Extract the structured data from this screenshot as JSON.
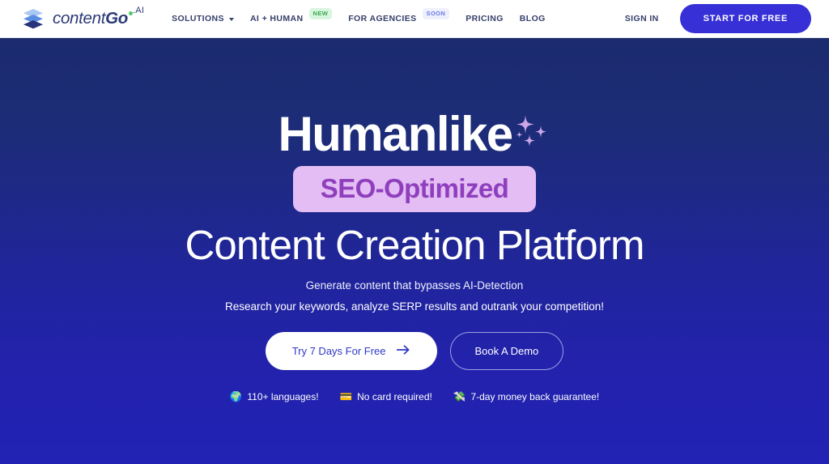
{
  "header": {
    "brand": {
      "logo_icon": "layers-stack-icon",
      "text_light": "content",
      "text_bold": "Go",
      "dot_color": "#4ec96a",
      "suffix": ".AI"
    },
    "nav": [
      {
        "label": "SOLUTIONS",
        "has_caret": true,
        "badge": null
      },
      {
        "label": "AI + HUMAN",
        "has_caret": false,
        "badge": "NEW",
        "badge_type": "new"
      },
      {
        "label": "FOR AGENCIES",
        "has_caret": false,
        "badge": "SOON",
        "badge_type": "soon"
      },
      {
        "label": "PRICING",
        "has_caret": false,
        "badge": null
      },
      {
        "label": "BLOG",
        "has_caret": false,
        "badge": null
      }
    ],
    "sign_in": "SIGN IN",
    "start_free": "START FOR FREE"
  },
  "hero": {
    "headline_line1": "Humanlike",
    "headline_badge": "SEO-Optimized",
    "headline_line3": "Content Creation Platform",
    "subtitle_1": "Generate content that bypasses AI-Detection",
    "subtitle_2": "Research your keywords, analyze SERP results and outrank your competition!",
    "cta_primary": "Try 7 Days For Free",
    "cta_secondary": "Book A Demo",
    "features": [
      {
        "emoji": "🌍",
        "icon_name": "globe-icon",
        "label": "110+ languages!"
      },
      {
        "emoji": "💳",
        "icon_name": "credit-card-icon",
        "label": "No card required!"
      },
      {
        "emoji": "💸",
        "icon_name": "money-flying-icon",
        "label": "7-day money back guarantee!"
      }
    ]
  },
  "colors": {
    "brand_navy": "#2b3a77",
    "accent_blue": "#3730d6",
    "badge_bg": "#e3bdf3",
    "badge_text": "#8f3fbe",
    "hero_top": "#1b2b6e",
    "hero_bottom": "#2222b4",
    "green_dot": "#4ec96a"
  }
}
